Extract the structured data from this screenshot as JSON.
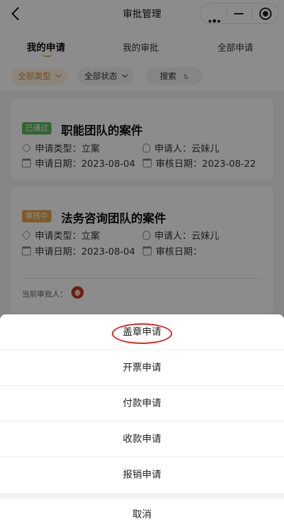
{
  "header": {
    "title": "审批管理",
    "back_icon": "chevron-left-icon",
    "capsule_icons": [
      "more-dots-icon",
      "minimize-icon",
      "target-icon"
    ]
  },
  "tabs": [
    {
      "label": "我的申请",
      "active": true
    },
    {
      "label": "我的审批",
      "active": false
    },
    {
      "label": "全部申请",
      "active": false
    }
  ],
  "filters": {
    "type": "全部类型",
    "status": "全部状态",
    "search": "搜索",
    "sort_icon": "⇅"
  },
  "cards": [
    {
      "badge": "已通过",
      "title": "职能团队的案件",
      "type_label": "申请类型：立案",
      "applicant_label": "申请人：云妹儿",
      "date_label": "申请日期：2023-08-04",
      "review_label": "审核日期：2023-08-22"
    },
    {
      "badge": "审核中",
      "title": "法务咨询团队的案件",
      "type_label": "申请类型：立案",
      "applicant_label": "申请人：云妹儿",
      "date_label": "申请日期：2023-08-04",
      "review_label": "审核日期：",
      "approver_label": "当前审批人："
    }
  ],
  "action_sheet": {
    "items": [
      "盖章申请",
      "开票申请",
      "付款申请",
      "收款申请",
      "报销申请"
    ],
    "cancel": "取消"
  },
  "colors": {
    "accent": "#f2a43a",
    "approved": "#5cb85c",
    "pending": "#e4a84e",
    "highlight_ring": "#e02020"
  }
}
